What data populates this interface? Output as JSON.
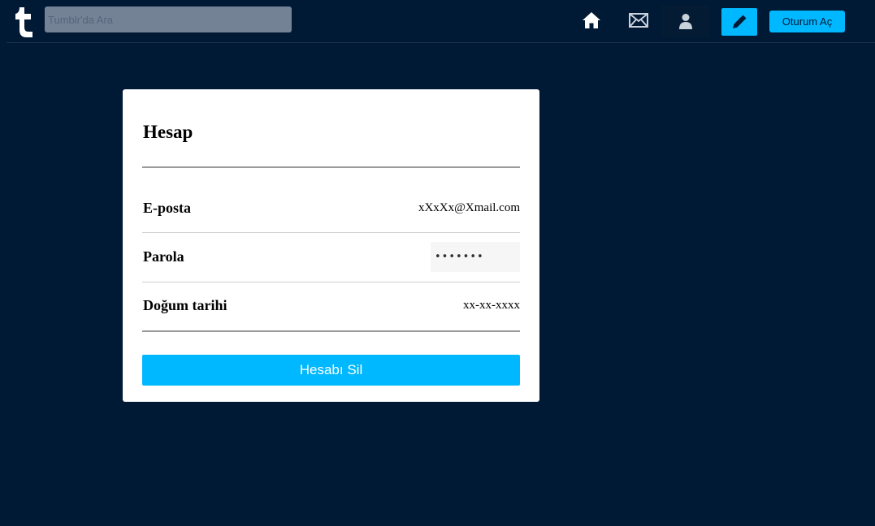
{
  "app": {
    "logo_icon": "tumblr-logo",
    "brand_color": "#001935",
    "accent_color": "#00b8ff"
  },
  "header": {
    "search": {
      "placeholder": "Tumblr'da Ara",
      "value": ""
    },
    "nav_icons": [
      "home-icon",
      "mail-icon",
      "user-icon",
      "pencil-icon"
    ],
    "login_label": "Oturum Aç"
  },
  "account": {
    "title": "Hesap",
    "rows": [
      {
        "label": "E-posta",
        "value": "xXxXx@Xmail.com"
      },
      {
        "label": "Parola",
        "value": "•••••••"
      },
      {
        "label": "Doğum tarihi",
        "value": "xx-xx-xxxx"
      }
    ],
    "delete_label": "Hesabı Sil"
  }
}
